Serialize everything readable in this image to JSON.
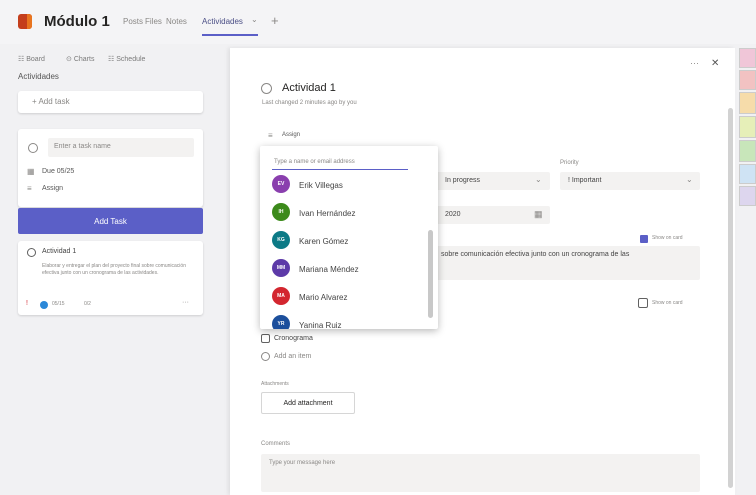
{
  "app": {
    "title": "Módulo 1"
  },
  "tabs": [
    "Posts",
    "Files",
    "Notes",
    "Actividades"
  ],
  "tab_chevron": "⌄",
  "add_tab": "+",
  "view": {
    "board": "Board",
    "charts": "Charts",
    "schedule": "Schedule"
  },
  "bucket": {
    "title": "Actividades",
    "add_task": "+  Add task",
    "new_task": {
      "name_placeholder": "Enter a task name",
      "due": "Due 05/25",
      "assign": "Assign",
      "add_button": "Add Task"
    },
    "task_card": {
      "title": "Actividad 1",
      "description": "Elaborar y entregar el plan del proyecto final sobre comunicación efectiva junto con un cronograma de las actividades.",
      "meta": "05/15",
      "meta2": "0/2"
    }
  },
  "panel": {
    "title": "Actividad 1",
    "subtitle": "Last changed 2 minutes ago by you",
    "assign": "Assign",
    "progress_value": "In progress",
    "priority_label": "Priority",
    "priority_value": "! Important",
    "date_value": "2020",
    "show_on_card": "Show on card",
    "notes": "sobre comunicación efectiva junto con un cronograma de las",
    "show_on_card2": "Show on card",
    "checklist": [
      "Cronograma"
    ],
    "add_item": "Add an item",
    "attachments_label": "Attachments",
    "add_attachment": "Add attachment",
    "comments_label": "Comments",
    "comment_placeholder": "Type your message here",
    "more": "···",
    "close": "✕"
  },
  "dropdown": {
    "search_placeholder": "Type a name or email address",
    "people": [
      {
        "name": "Erik Villegas",
        "initials": "EV",
        "color": "#8a3fae"
      },
      {
        "name": "Ivan Hernández",
        "initials": "IH",
        "color": "#3c8a1b"
      },
      {
        "name": "Karen Gómez",
        "initials": "KG",
        "color": "#0c7a86"
      },
      {
        "name": "Mariana Méndez",
        "initials": "MM",
        "color": "#5d3aa8"
      },
      {
        "name": "Mario Alvarez",
        "initials": "MA",
        "color": "#d3262f"
      },
      {
        "name": "Yanina Ruiz",
        "initials": "YR",
        "color": "#1c4f9c"
      }
    ]
  },
  "icons": {
    "calendar": "calendar-icon",
    "assign": "assign-icon"
  }
}
